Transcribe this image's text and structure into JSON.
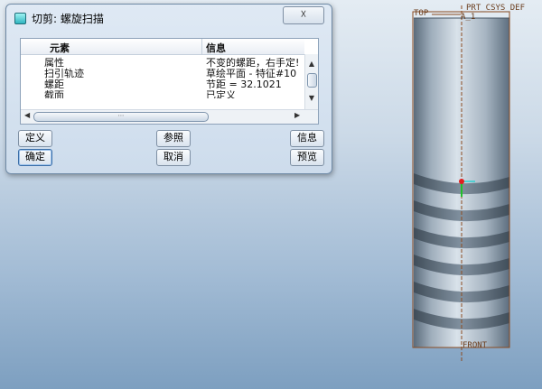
{
  "dialog": {
    "title": "切剪: 螺旋扫描",
    "close_label": "☓",
    "columns": [
      "元素",
      "信息"
    ],
    "rows": [
      {
        "element": "属性",
        "info": "不变的螺距，右手定!"
      },
      {
        "element": "扫引轨迹",
        "info": "草绘平面 - 特征#10"
      },
      {
        "element": "螺距",
        "info": "节距 = 32.1021"
      },
      {
        "element": "截面",
        "info": "已定义"
      }
    ],
    "buttons": {
      "define": "定义",
      "refs": "参照",
      "info": "信息",
      "ok": "确定",
      "cancel": "取消",
      "preview": "预览"
    },
    "hscroll_grip": "⋯"
  },
  "model": {
    "datum_top": "TOP",
    "datum_csys": "PRT_CSYS_DEF",
    "datum_a1": "A_1",
    "datum_front": "FRONT",
    "colors": {
      "datum": "#8b4a1f",
      "csys_origin": "#e02020",
      "axis_green": "#22c02a",
      "axis_cyan": "#2bd0d0"
    }
  }
}
